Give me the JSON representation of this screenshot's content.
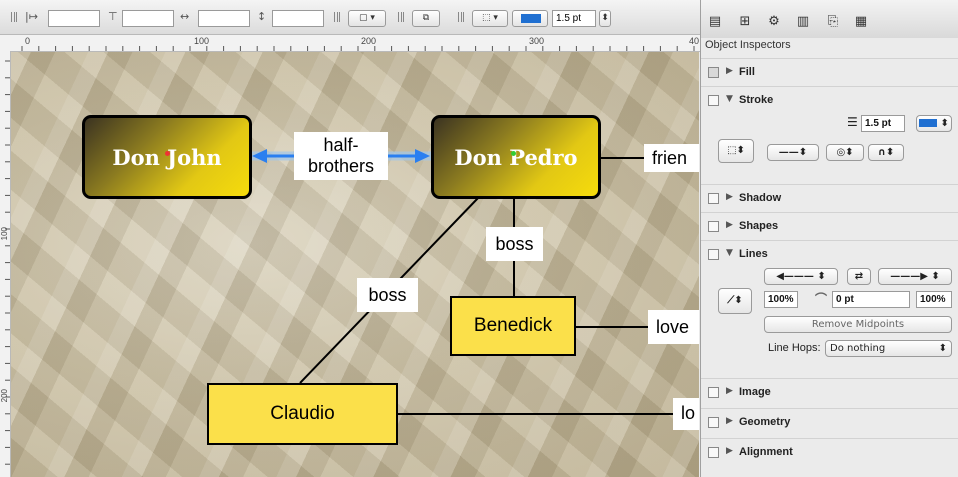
{
  "toolbar": {
    "x_field": "",
    "y_field": "",
    "w_field": "",
    "h_field": "",
    "stroke_width": "1.5 pt",
    "stroke_color": "#1f6fd1"
  },
  "ruler": {
    "top_labels": [
      "0",
      "100",
      "200",
      "300",
      "40"
    ],
    "left_labels": [
      "100",
      "200"
    ]
  },
  "diagram": {
    "nodes": {
      "don_john": "Don John",
      "don_pedro": "Don Pedro",
      "benedick": "Benedick",
      "claudio": "Claudio"
    },
    "labels": {
      "half_brothers": "half-\nbrothers",
      "friends": "frien",
      "boss_pedro_benedick": "boss",
      "boss_pedro_claudio": "boss",
      "love_benedick": "love",
      "love_claudio": "lo"
    },
    "connector_color": "#2a7ff0"
  },
  "inspector": {
    "title": "Object Inspectors",
    "tabs": [
      "style-tab",
      "layout-tab",
      "gear-tab",
      "document-tab",
      "export-tab",
      "grid-tab"
    ],
    "sections": {
      "fill": "Fill",
      "stroke": "Stroke",
      "shadow": "Shadow",
      "shapes": "Shapes",
      "lines": "Lines",
      "image": "Image",
      "geometry": "Geometry",
      "alignment": "Alignment"
    },
    "stroke": {
      "width": "1.5 pt",
      "color": "#1f6fd1"
    },
    "lines": {
      "start_scale": "100%",
      "corner_radius": "0 pt",
      "end_scale": "100%",
      "remove_midpoints": "Remove Midpoints",
      "line_hops_label": "Line Hops:",
      "line_hops_value": "Do nothing"
    }
  }
}
